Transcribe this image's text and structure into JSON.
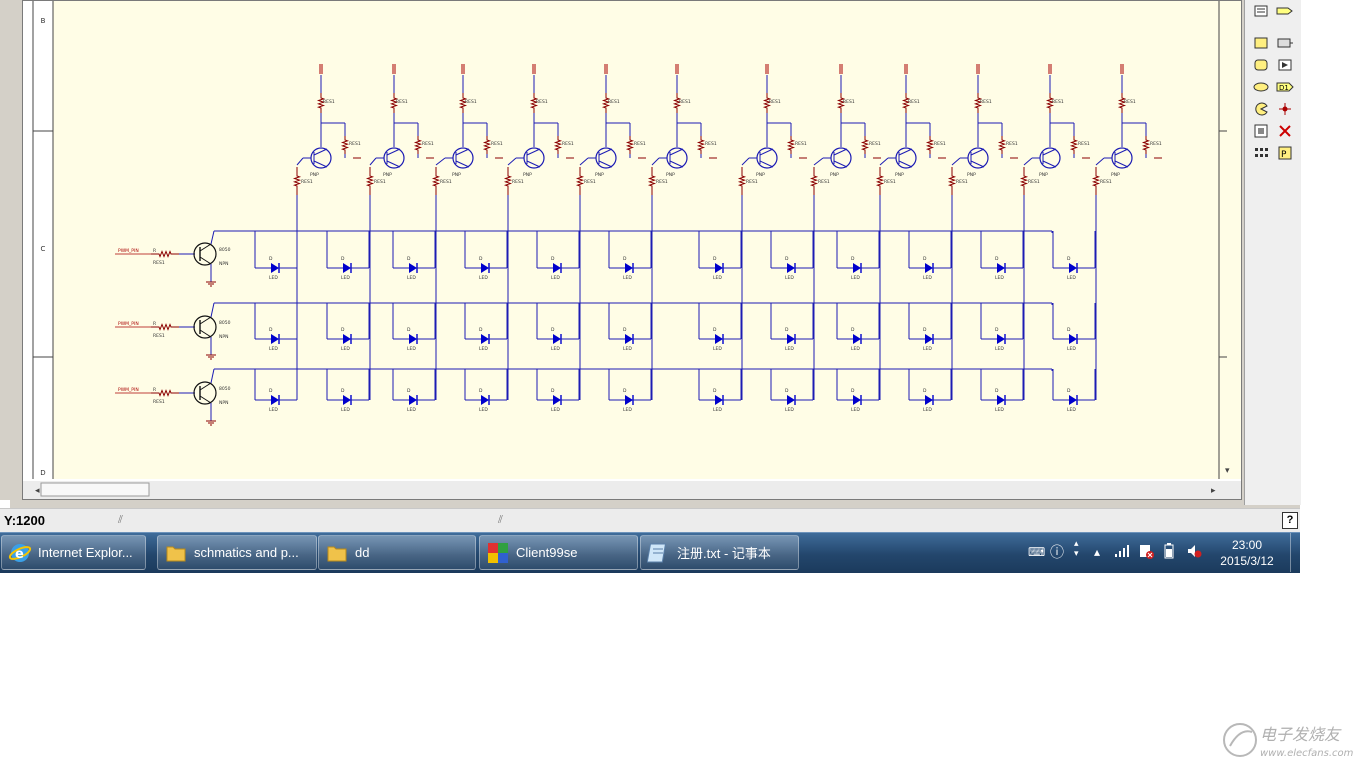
{
  "status_bar": {
    "coords": "Y:1200"
  },
  "taskbar": {
    "items": [
      {
        "label": "Internet Explor...",
        "icon": "internet-explorer-icon"
      },
      {
        "label": "schmatics and p...",
        "icon": "folder-icon"
      },
      {
        "label": "dd",
        "icon": "folder-icon"
      },
      {
        "label": "Client99se",
        "icon": "client99se-icon"
      },
      {
        "label": "注册.txt - 记事本",
        "icon": "notepad-icon"
      }
    ],
    "clock": {
      "time": "23:00",
      "date": "2015/3/12"
    }
  },
  "schematic": {
    "top_label": "PNP",
    "driver_label": "PWM_PIN",
    "driver_type": "NPN",
    "driver_part": "8050",
    "resistor_label": "RES1",
    "led_label": "LED",
    "border_letters": [
      "B",
      "C",
      "D"
    ]
  },
  "palette": [
    "sheet-symbol",
    "port",
    "rect",
    "rect-hatched",
    "rounded-rect",
    "image-box",
    "ellipse",
    "d1-port",
    "pie",
    "junction",
    "graphic",
    "no-erc",
    "array",
    "probe"
  ],
  "watermark": {
    "text": "电子发烧友",
    "url": "www.elecfans.com"
  },
  "colors": {
    "sheet": "#fffde6",
    "wire": "#1c1cb4",
    "led": "#0000cc",
    "resistor": "#8b0000",
    "pin": "#aa0000",
    "taskbar": "#23466c"
  }
}
